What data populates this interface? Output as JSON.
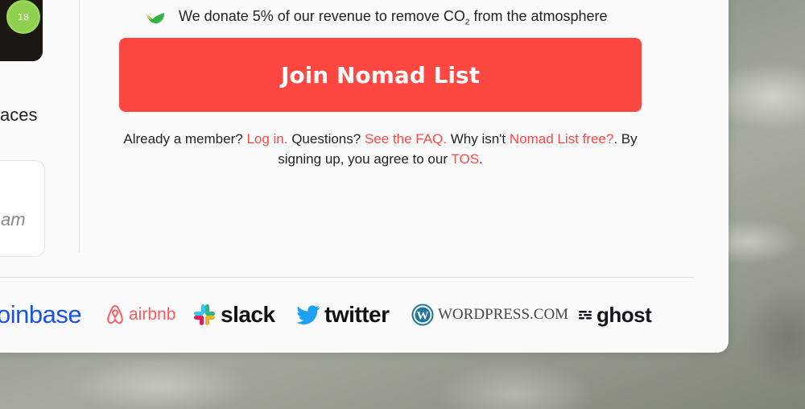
{
  "background": {
    "description_color": "#8e958a"
  },
  "sidebar": {
    "avatar_badge": "18",
    "partial_text": "aces",
    "partial_card_text": "am"
  },
  "donate": {
    "icon": "leaf-icon",
    "text_before": "We donate 5% of our revenue to remove CO",
    "subscript": "2",
    "text_after": " from the atmosphere"
  },
  "join_button": {
    "label": "Join Nomad List",
    "color": "#ff4742"
  },
  "member_info": {
    "already_member": "Already a member? ",
    "login_link": "Log in.",
    "questions": " Questions? ",
    "faq_link": "See the FAQ.",
    "why_not": " Why isn't ",
    "free_link": "Nomad List free?",
    "agree": ". By signing up, you agree to our ",
    "tos_link": "TOS",
    "end": "."
  },
  "logos": {
    "coinbase": "oinbase",
    "airbnb": "airbnb",
    "slack": "slack",
    "twitter": "twitter",
    "wordpress": "WORDPRESS.COM",
    "ghost": "ghost"
  },
  "colors": {
    "accent": "#ff4742",
    "coinbase": "#1652f0",
    "twitter": "#1da1f2"
  }
}
